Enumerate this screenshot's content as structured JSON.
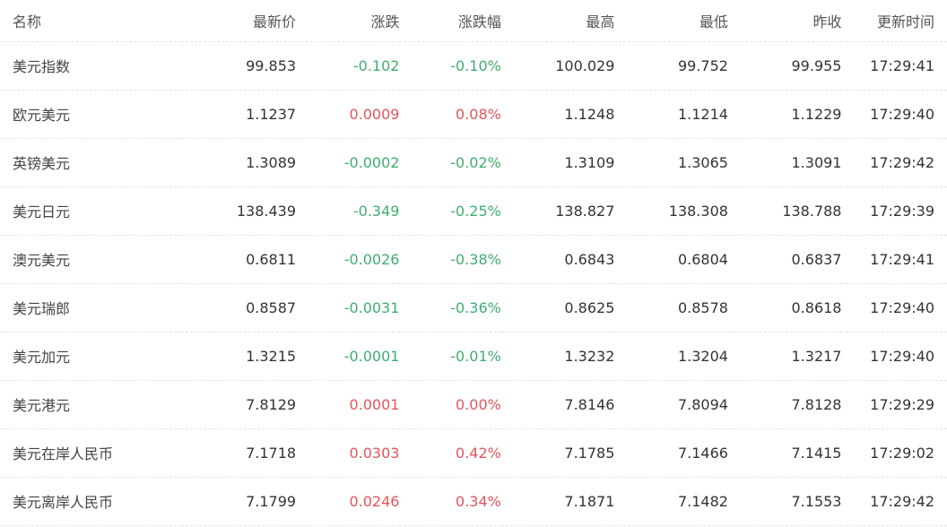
{
  "columns": [
    "名称",
    "最新价",
    "涨跌",
    "涨跌幅",
    "最高",
    "最低",
    "昨收",
    "更新时间"
  ],
  "colors": {
    "up": "#e3555c",
    "down": "#3fae70"
  },
  "rows": [
    {
      "name": "美元指数",
      "last": "99.853",
      "change": "-0.102",
      "pct": "-0.10%",
      "high": "100.029",
      "low": "99.752",
      "prev": "99.955",
      "time": "17:29:41",
      "dir": "down"
    },
    {
      "name": "欧元美元",
      "last": "1.1237",
      "change": "0.0009",
      "pct": "0.08%",
      "high": "1.1248",
      "low": "1.1214",
      "prev": "1.1229",
      "time": "17:29:40",
      "dir": "up"
    },
    {
      "name": "英镑美元",
      "last": "1.3089",
      "change": "-0.0002",
      "pct": "-0.02%",
      "high": "1.3109",
      "low": "1.3065",
      "prev": "1.3091",
      "time": "17:29:42",
      "dir": "down"
    },
    {
      "name": "美元日元",
      "last": "138.439",
      "change": "-0.349",
      "pct": "-0.25%",
      "high": "138.827",
      "low": "138.308",
      "prev": "138.788",
      "time": "17:29:39",
      "dir": "down"
    },
    {
      "name": "澳元美元",
      "last": "0.6811",
      "change": "-0.0026",
      "pct": "-0.38%",
      "high": "0.6843",
      "low": "0.6804",
      "prev": "0.6837",
      "time": "17:29:41",
      "dir": "down"
    },
    {
      "name": "美元瑞郎",
      "last": "0.8587",
      "change": "-0.0031",
      "pct": "-0.36%",
      "high": "0.8625",
      "low": "0.8578",
      "prev": "0.8618",
      "time": "17:29:40",
      "dir": "down"
    },
    {
      "name": "美元加元",
      "last": "1.3215",
      "change": "-0.0001",
      "pct": "-0.01%",
      "high": "1.3232",
      "low": "1.3204",
      "prev": "1.3217",
      "time": "17:29:40",
      "dir": "down"
    },
    {
      "name": "美元港元",
      "last": "7.8129",
      "change": "0.0001",
      "pct": "0.00%",
      "high": "7.8146",
      "low": "7.8094",
      "prev": "7.8128",
      "time": "17:29:29",
      "dir": "up"
    },
    {
      "name": "美元在岸人民币",
      "last": "7.1718",
      "change": "0.0303",
      "pct": "0.42%",
      "high": "7.1785",
      "low": "7.1466",
      "prev": "7.1415",
      "time": "17:29:02",
      "dir": "up"
    },
    {
      "name": "美元离岸人民币",
      "last": "7.1799",
      "change": "0.0246",
      "pct": "0.34%",
      "high": "7.1871",
      "low": "7.1482",
      "prev": "7.1553",
      "time": "17:29:42",
      "dir": "up"
    }
  ]
}
